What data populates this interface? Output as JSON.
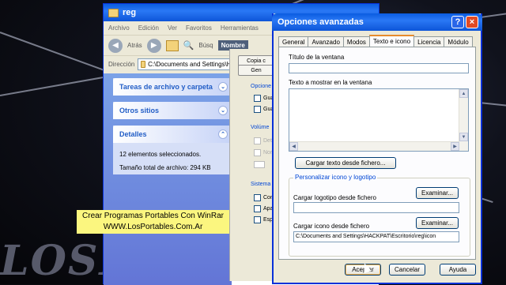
{
  "explorer": {
    "title": "reg",
    "menu": [
      "Archivo",
      "Edición",
      "Ver",
      "Favoritos",
      "Herramientas"
    ],
    "toolbar": {
      "back": "Atrás",
      "search": "Búsq",
      "folder_label": "Nombre"
    },
    "address": {
      "label": "Dirección",
      "value": "C:\\Documents and Settings\\HACKPAT"
    },
    "tasks": {
      "file_tasks": "Tareas de archivo y carpeta",
      "other_places": "Otros sitios",
      "details": {
        "title": "Detalles",
        "selected": "12 elementos seleccionados.",
        "total_size": "Tamaño total de archivo: 294 KB"
      }
    }
  },
  "background_dialog": {
    "copy_button": "Copia c",
    "gen_button": "Gen",
    "groups": [
      "Opcione",
      "Volúme",
      "Sistema"
    ],
    "checkbox_labels": [
      "Gua",
      "Gua",
      "Dete",
      "Nor",
      "Con",
      "Apa",
      "Esp"
    ]
  },
  "overlay": {
    "line1": "Crear Programas Portables Con WinRar",
    "line2": "WWW.LosPortables.Com.Ar",
    "watermark": "LOSPORT"
  },
  "dialog": {
    "title": "Opciones avanzadas",
    "title_help": "?",
    "title_close": "×",
    "tabs": [
      {
        "label": "General",
        "selected": false
      },
      {
        "label": "Avanzado",
        "selected": false
      },
      {
        "label": "Modos",
        "selected": false
      },
      {
        "label": "Texto e icono",
        "selected": true
      },
      {
        "label": "Licencia",
        "selected": false
      },
      {
        "label": "Módulo",
        "selected": false
      }
    ],
    "window_title_label": "Título de la ventana",
    "window_text_label": "Texto a mostrar en la ventana",
    "load_text_button": "Cargar texto desde fichero...",
    "customize_group": "Personalizar icono y logotipo",
    "logo_label": "Cargar logotipo desde fichero",
    "logo_browse": "Examinar...",
    "icon_label": "Cargar icono desde fichero",
    "icon_browse": "Examinar...",
    "icon_path": "C:\\Documents and Settings\\HACKPAT\\Escritorio\\reg\\icon",
    "ok": "Aceptar",
    "cancel": "Cancelar",
    "help": "Ayuda"
  }
}
